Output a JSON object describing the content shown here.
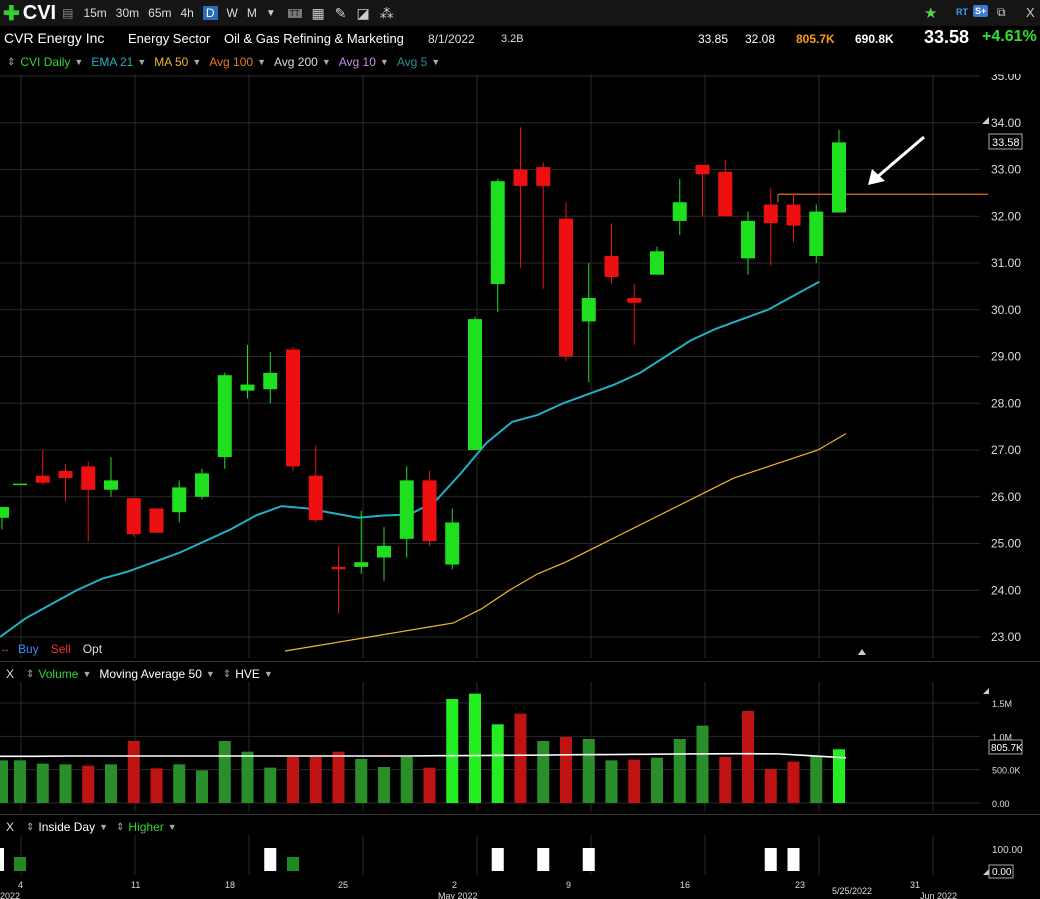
{
  "toolbar": {
    "ticker": "CVI",
    "timeframes": [
      "15m",
      "30m",
      "65m",
      "4h",
      "D",
      "W",
      "M"
    ],
    "active_timeframe": "D",
    "icons_left": [
      "chart-type-icon",
      "calculator-icon",
      "pencil-icon",
      "tag-icon",
      "share-icon"
    ],
    "icons_right": [
      "star-icon",
      "realtime-icon",
      "s-icon",
      "expand-icon",
      "close-icon"
    ],
    "rt_label": "RT",
    "s_label": "S+",
    "close_label": "X"
  },
  "info": {
    "company": "CVR Energy Inc",
    "sector": "Energy Sector",
    "industry": "Oil & Gas Refining & Marketing",
    "earnings_date": "8/1/2022",
    "market_cap": "3.2B",
    "high": "33.85",
    "low": "32.08",
    "volume": "805.7K",
    "avg_volume": "690.8K",
    "last": "33.58",
    "change": "+4.61%"
  },
  "studies": [
    {
      "label": "CVI Daily",
      "color": "#33d633"
    },
    {
      "label": "EMA 21",
      "color": "#21b1c4"
    },
    {
      "label": "MA 50",
      "color": "#f0b82a"
    },
    {
      "label": "Avg 100",
      "color": "#ee7a1a"
    },
    {
      "label": "Avg 200",
      "color": "#dddddd"
    },
    {
      "label": "Avg 10",
      "color": "#c98ee8"
    },
    {
      "label": "Avg 5",
      "color": "#2a8f96"
    }
  ],
  "trade_buttons": {
    "buy": "Buy",
    "sell": "Sell",
    "opt": "Opt"
  },
  "volume_pane": {
    "close": "X",
    "label": "Volume",
    "ma_label": "Moving Average 50",
    "hve_label": "HVE",
    "axis_labels": [
      "1.5M",
      "1.0M",
      "500.0K",
      "0.00"
    ],
    "current_label": "805.7K"
  },
  "bottom_pane": {
    "close": "X",
    "inside_label": "Inside Day",
    "higher_label": "Higher",
    "axis_labels": [
      "100.00",
      "0.00"
    ]
  },
  "price_axis_labels": [
    "35.00",
    "34.00",
    "33.00",
    "32.00",
    "31.00",
    "30.00",
    "29.00",
    "28.00",
    "27.00",
    "26.00",
    "25.00",
    "24.00",
    "23.00"
  ],
  "current_price_label": "33.58",
  "date_labels": [
    "2022",
    "4",
    "11",
    "18",
    "25",
    "May 2022",
    "2",
    "9",
    "16",
    "23",
    "5/25/2022",
    "31",
    "Jun 2022"
  ],
  "colors": {
    "up": "#1fe01f",
    "down": "#ee1010",
    "ema": "#21b1c4",
    "ma": "#f0b82a",
    "level": "#d8702a"
  },
  "chart_data": {
    "type": "candlestick",
    "candles": [
      {
        "d": "4/1",
        "o": 25.55,
        "h": 25.78,
        "l": 25.3,
        "c": 25.78
      },
      {
        "d": "4/4",
        "o": 26.28,
        "h": 26.28,
        "l": 26.28,
        "c": 26.28
      },
      {
        "d": "4/5",
        "o": 26.45,
        "h": 27.0,
        "l": 26.25,
        "c": 26.3
      },
      {
        "d": "4/6",
        "o": 26.55,
        "h": 26.7,
        "l": 25.9,
        "c": 26.4
      },
      {
        "d": "4/7",
        "o": 26.65,
        "h": 26.75,
        "l": 25.05,
        "c": 26.15
      },
      {
        "d": "4/8",
        "o": 26.15,
        "h": 26.85,
        "l": 26.0,
        "c": 26.35
      },
      {
        "d": "4/11",
        "o": 25.97,
        "h": 25.97,
        "l": 25.15,
        "c": 25.2
      },
      {
        "d": "4/12",
        "o": 25.75,
        "h": 25.75,
        "l": 25.25,
        "c": 25.23
      },
      {
        "d": "4/13",
        "o": 25.67,
        "h": 26.35,
        "l": 25.45,
        "c": 26.2
      },
      {
        "d": "4/14",
        "o": 26.0,
        "h": 26.6,
        "l": 25.95,
        "c": 26.5
      },
      {
        "d": "4/18",
        "o": 26.85,
        "h": 28.65,
        "l": 26.6,
        "c": 28.6
      },
      {
        "d": "4/19",
        "o": 28.27,
        "h": 29.25,
        "l": 28.1,
        "c": 28.4
      },
      {
        "d": "4/20",
        "o": 28.3,
        "h": 29.1,
        "l": 28.0,
        "c": 28.65
      },
      {
        "d": "4/21",
        "o": 29.15,
        "h": 29.2,
        "l": 26.55,
        "c": 26.65
      },
      {
        "d": "4/22",
        "o": 26.45,
        "h": 27.1,
        "l": 25.45,
        "c": 25.5
      },
      {
        "d": "4/25",
        "o": 24.5,
        "h": 24.95,
        "l": 23.5,
        "c": 24.45
      },
      {
        "d": "4/26",
        "o": 24.5,
        "h": 25.7,
        "l": 24.35,
        "c": 24.6
      },
      {
        "d": "4/27",
        "o": 24.7,
        "h": 25.35,
        "l": 24.2,
        "c": 24.95
      },
      {
        "d": "4/28",
        "o": 25.1,
        "h": 26.65,
        "l": 24.7,
        "c": 26.35
      },
      {
        "d": "4/29",
        "o": 26.35,
        "h": 26.55,
        "l": 24.95,
        "c": 25.05
      },
      {
        "d": "5/2",
        "o": 24.55,
        "h": 25.75,
        "l": 24.45,
        "c": 25.45
      },
      {
        "d": "5/3",
        "o": 27.0,
        "h": 29.85,
        "l": 27.0,
        "c": 29.8
      },
      {
        "d": "5/4",
        "o": 30.55,
        "h": 32.8,
        "l": 29.95,
        "c": 32.75
      },
      {
        "d": "5/5",
        "o": 33.0,
        "h": 33.9,
        "l": 30.9,
        "c": 32.65
      },
      {
        "d": "5/6",
        "o": 33.05,
        "h": 33.15,
        "l": 30.45,
        "c": 32.65
      },
      {
        "d": "5/9",
        "o": 31.95,
        "h": 32.3,
        "l": 28.9,
        "c": 29.0
      },
      {
        "d": "5/10",
        "o": 29.75,
        "h": 31.0,
        "l": 28.45,
        "c": 30.25
      },
      {
        "d": "5/11",
        "o": 31.15,
        "h": 31.85,
        "l": 30.55,
        "c": 30.7
      },
      {
        "d": "5/12",
        "o": 30.25,
        "h": 30.55,
        "l": 29.25,
        "c": 30.15
      },
      {
        "d": "5/13",
        "o": 30.75,
        "h": 31.35,
        "l": 30.75,
        "c": 31.25
      },
      {
        "d": "5/16",
        "o": 31.9,
        "h": 32.8,
        "l": 31.6,
        "c": 32.3
      },
      {
        "d": "5/17",
        "o": 33.1,
        "h": 33.1,
        "l": 32.0,
        "c": 32.9
      },
      {
        "d": "5/18",
        "o": 32.95,
        "h": 33.2,
        "l": 32.0,
        "c": 32.0
      },
      {
        "d": "5/19",
        "o": 31.1,
        "h": 32.1,
        "l": 30.75,
        "c": 31.9
      },
      {
        "d": "5/20",
        "o": 32.25,
        "h": 32.6,
        "l": 30.95,
        "c": 31.85
      },
      {
        "d": "5/23",
        "o": 32.25,
        "h": 32.5,
        "l": 31.45,
        "c": 31.8
      },
      {
        "d": "5/24",
        "o": 31.15,
        "h": 32.25,
        "l": 31.0,
        "c": 32.1
      },
      {
        "d": "5/25",
        "o": 32.08,
        "h": 33.85,
        "l": 32.08,
        "c": 33.58
      }
    ],
    "ema21": [
      23.0,
      23.4,
      23.7,
      24.0,
      24.25,
      24.4,
      24.6,
      24.8,
      25.05,
      25.3,
      25.6,
      25.8,
      25.75,
      25.65,
      25.55,
      25.6,
      25.62,
      25.9,
      26.5,
      27.15,
      27.6,
      27.75,
      28.0,
      28.2,
      28.4,
      28.65,
      29.0,
      29.35,
      29.6,
      29.8,
      30.0,
      30.3,
      30.6
    ],
    "ma50": [
      22.7,
      22.8,
      22.9,
      23.0,
      23.1,
      23.2,
      23.3,
      23.6,
      24.0,
      24.35,
      24.6,
      24.9,
      25.2,
      25.5,
      25.8,
      26.1,
      26.4,
      26.6,
      26.8,
      27.0,
      27.35
    ],
    "volume": [
      {
        "v": 640000,
        "up": true
      },
      {
        "v": 640000,
        "up": true
      },
      {
        "v": 590000,
        "up": true
      },
      {
        "v": 580000,
        "up": true
      },
      {
        "v": 560000,
        "up": false
      },
      {
        "v": 580000,
        "up": true
      },
      {
        "v": 930000,
        "up": false
      },
      {
        "v": 520000,
        "up": false
      },
      {
        "v": 580000,
        "up": true
      },
      {
        "v": 490000,
        "up": true
      },
      {
        "v": 930000,
        "up": true
      },
      {
        "v": 770000,
        "up": true
      },
      {
        "v": 530000,
        "up": true
      },
      {
        "v": 690000,
        "up": false
      },
      {
        "v": 690000,
        "up": false
      },
      {
        "v": 770000,
        "up": false
      },
      {
        "v": 660000,
        "up": true
      },
      {
        "v": 540000,
        "up": true
      },
      {
        "v": 690000,
        "up": true
      },
      {
        "v": 530000,
        "up": false
      },
      {
        "v": 1560000,
        "up": true
      },
      {
        "v": 1640000,
        "up": true
      },
      {
        "v": 1180000,
        "up": true
      },
      {
        "v": 1340000,
        "up": false
      },
      {
        "v": 930000,
        "up": true
      },
      {
        "v": 990000,
        "up": false
      },
      {
        "v": 960000,
        "up": true
      },
      {
        "v": 640000,
        "up": true
      },
      {
        "v": 650000,
        "up": false
      },
      {
        "v": 680000,
        "up": true
      },
      {
        "v": 960000,
        "up": true
      },
      {
        "v": 1160000,
        "up": true
      },
      {
        "v": 690000,
        "up": false
      },
      {
        "v": 1380000,
        "up": false
      },
      {
        "v": 510000,
        "up": false
      },
      {
        "v": 620000,
        "up": false
      },
      {
        "v": 710000,
        "up": true
      },
      {
        "v": 805700,
        "up": true
      }
    ],
    "inside_day_up": [
      "4/20",
      "5/10",
      "5/20",
      "5/23"
    ],
    "higher_markers": [
      "4/4",
      "4/21"
    ],
    "ylim": [
      22.5,
      35.3
    ],
    "level_line": 32.47
  }
}
